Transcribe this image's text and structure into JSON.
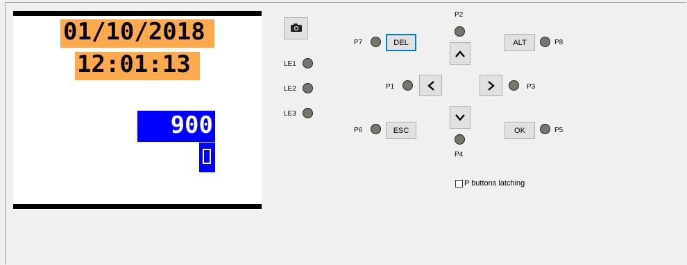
{
  "lcd": {
    "date": "01/10/2018",
    "time": "12:01:13",
    "value": "900"
  },
  "camera": {
    "icon": "camera-icon"
  },
  "leds": {
    "le1": "LE1",
    "le2": "LE2",
    "le3": "LE3"
  },
  "buttons": {
    "del": "DEL",
    "esc": "ESC",
    "alt": "ALT",
    "ok": "OK"
  },
  "p_labels": {
    "p1": "P1",
    "p2": "P2",
    "p3": "P3",
    "p4": "P4",
    "p5": "P5",
    "p6": "P6",
    "p7": "P7",
    "p8": "P8"
  },
  "latching": {
    "label": "P buttons latching",
    "checked": false
  },
  "colors": {
    "lcd_highlight": "#ffa94d",
    "lcd_selection": "#0000ff",
    "led_off": "#6f7a6a",
    "focus": "#0078d7"
  }
}
